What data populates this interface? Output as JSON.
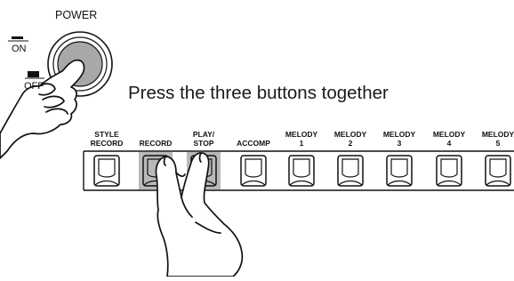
{
  "power": {
    "title": "POWER",
    "on_label": "ON",
    "off_label": "OFF"
  },
  "instruction": "Press the three buttons together",
  "buttons": [
    {
      "line1": "STYLE",
      "line2": "RECORD",
      "pressed": false
    },
    {
      "line1": "RECORD",
      "line2": "",
      "pressed": true
    },
    {
      "line1": "PLAY/",
      "line2": "STOP",
      "pressed": true
    },
    {
      "line1": "ACCOMP",
      "line2": "",
      "pressed": false
    },
    {
      "line1": "MELODY",
      "line2": "1",
      "pressed": false
    },
    {
      "line1": "MELODY",
      "line2": "2",
      "pressed": false
    },
    {
      "line1": "MELODY",
      "line2": "3",
      "pressed": false
    },
    {
      "line1": "MELODY",
      "line2": "4",
      "pressed": false
    },
    {
      "line1": "MELODY",
      "line2": "5",
      "pressed": false
    }
  ],
  "colors": {
    "pressed_fill": "#b9b9b9",
    "knob_fill": "#a8a8a8",
    "stroke": "#111111"
  }
}
